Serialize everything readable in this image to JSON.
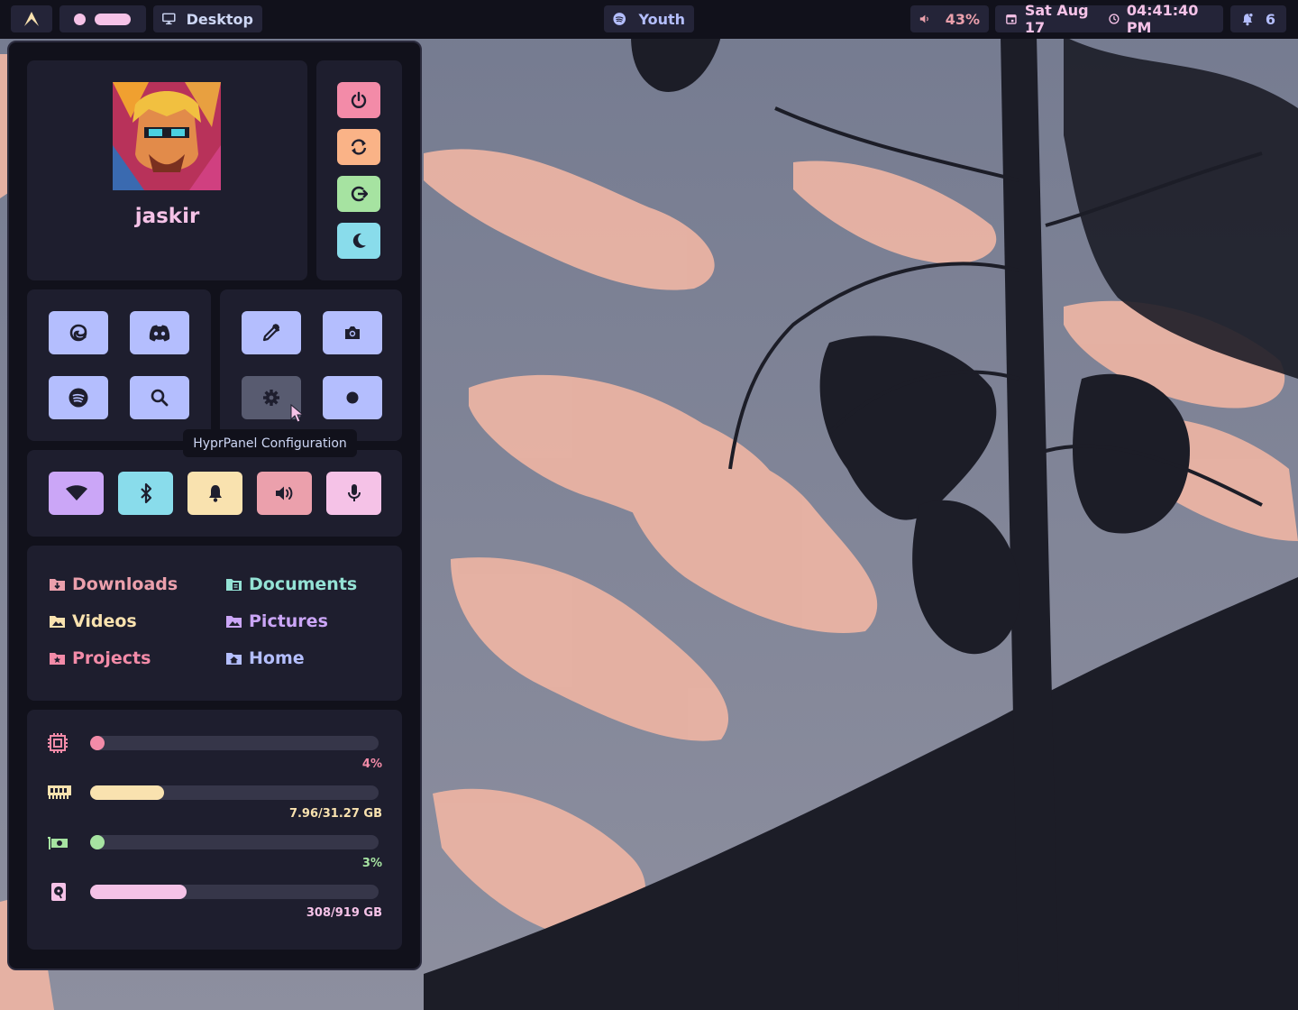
{
  "topbar": {
    "workspace_name": "Desktop",
    "media_title": "Youth",
    "volume": "43%",
    "date": "Sat Aug 17",
    "time": "04:41:40 PM",
    "notification_count": "6"
  },
  "profile": {
    "username": "jaskir"
  },
  "power_buttons": [
    {
      "icon": "power-icon",
      "color": "#f38ba8"
    },
    {
      "icon": "restart-icon",
      "color": "#fab387"
    },
    {
      "icon": "logout-icon",
      "color": "#a6e3a1"
    },
    {
      "icon": "sleep-moon-icon",
      "color": "#89dceb"
    }
  ],
  "shortcuts_left": [
    "edge-browser-icon",
    "discord-icon",
    "spotify-icon",
    "search-icon"
  ],
  "shortcuts_right": [
    "color-picker-icon",
    "camera-icon",
    "settings-gear-icon",
    "record-dot-icon"
  ],
  "tooltip": "HyprPanel Configuration",
  "toggles": [
    {
      "icon": "wifi-icon",
      "color": "#cba6f7"
    },
    {
      "icon": "bluetooth-icon",
      "color": "#89dceb"
    },
    {
      "icon": "bell-icon",
      "color": "#f9e2af"
    },
    {
      "icon": "volume-icon",
      "color": "#eba0ac"
    },
    {
      "icon": "microphone-icon",
      "color": "#f5c2e7"
    }
  ],
  "directories": {
    "left": [
      {
        "label": "Downloads",
        "color": "#eba0ac"
      },
      {
        "label": "Videos",
        "color": "#f9e2af"
      },
      {
        "label": "Projects",
        "color": "#f38ba8"
      }
    ],
    "right": [
      {
        "label": "Documents",
        "color": "#94e2d5"
      },
      {
        "label": "Pictures",
        "color": "#cba6f7"
      },
      {
        "label": "Home",
        "color": "#b4befe"
      }
    ]
  },
  "stats": {
    "cpu": {
      "label": "4%",
      "percent": 4,
      "color": "#f38ba8",
      "icon": "cpu-icon"
    },
    "ram": {
      "label": "7.96/31.27 GB",
      "percent": 25.5,
      "color": "#f9e2af",
      "icon": "ram-icon"
    },
    "gpu": {
      "label": "3%",
      "percent": 3,
      "color": "#a6e3a1",
      "icon": "gpu-icon"
    },
    "disk": {
      "label": "308/919 GB",
      "percent": 33.5,
      "color": "#f5c2e7",
      "icon": "disk-icon"
    }
  },
  "colors": {
    "bar_bg": "#11111b",
    "card_bg": "#1e1e2e",
    "accent": "#b4befe",
    "text": "#cdd6f4"
  }
}
